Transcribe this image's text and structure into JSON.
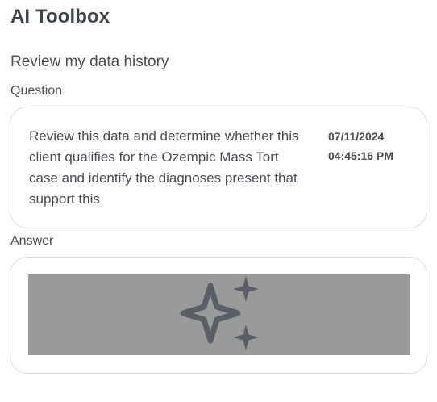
{
  "app": {
    "title": "AI Toolbox"
  },
  "page": {
    "subtitle": "Review my data history"
  },
  "question": {
    "label": "Question",
    "text": "Review this data and determine whether this client qualifies for the Ozempic Mass Tort case and identify the diagnoses present that support this",
    "date": "07/11/2024",
    "time": "04:45:16 PM"
  },
  "answer": {
    "label": "Answer",
    "icon": "sparkle-icon",
    "placeholder_color": "#9a9a9a",
    "icon_color": "#5a5e66"
  }
}
